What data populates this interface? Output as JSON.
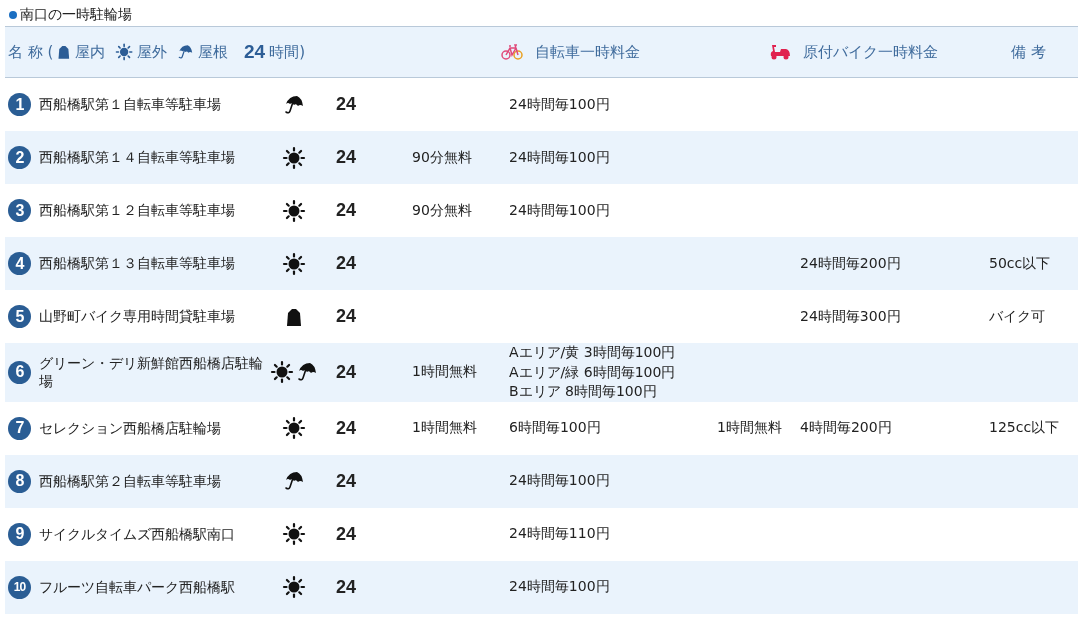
{
  "title": "南口の一時駐輪場",
  "header": {
    "name_label": "名 称 (",
    "legend": [
      {
        "kind": "indoor",
        "label": "屋内"
      },
      {
        "kind": "outdoor",
        "label": "屋外"
      },
      {
        "kind": "roof",
        "label": "屋根"
      },
      {
        "kind": "hours",
        "mark": "24",
        "label": "時間)"
      }
    ],
    "bicycle_fee": "自転車一時料金",
    "moped_fee": "原付バイク一時料金",
    "remarks": "備 考"
  },
  "rows": [
    {
      "number": "1",
      "name": "西船橋駅第１自転車等駐車場",
      "facilities": {
        "outdoor": false,
        "roof": true,
        "indoor": false
      },
      "hours": "24",
      "bicycle_fee": [
        "24時間毎100円"
      ]
    },
    {
      "number": "2",
      "name": "西船橋駅第１４自転車等駐車場",
      "facilities": {
        "outdoor": true,
        "roof": false,
        "indoor": false
      },
      "hours": "24",
      "bicycle_free": "90分無料",
      "bicycle_fee": [
        "24時間毎100円"
      ]
    },
    {
      "number": "3",
      "name": "西船橋駅第１２自転車等駐車場",
      "facilities": {
        "outdoor": true,
        "roof": false,
        "indoor": false
      },
      "hours": "24",
      "bicycle_free": "90分無料",
      "bicycle_fee": [
        "24時間毎100円"
      ]
    },
    {
      "number": "4",
      "name": "西船橋駅第１３自転車等駐車場",
      "facilities": {
        "outdoor": true,
        "roof": false,
        "indoor": false
      },
      "hours": "24",
      "moped_fee": "24時間毎200円",
      "remarks": "50cc以下"
    },
    {
      "number": "5",
      "name": "山野町バイク専用時間貸駐車場",
      "facilities": {
        "outdoor": false,
        "roof": false,
        "indoor": true
      },
      "hours": "24",
      "moped_fee": "24時間毎300円",
      "remarks": "バイク可"
    },
    {
      "number": "6",
      "name": "グリーン・デリ新鮮館西船橋店駐輪場",
      "facilities": {
        "outdoor": true,
        "roof": true,
        "indoor": false
      },
      "hours": "24",
      "bicycle_free": "1時間無料",
      "bicycle_fee": [
        "Aエリア/黄 3時間毎100円",
        "Aエリア/緑 6時間毎100円",
        "Bエリア 8時間毎100円"
      ]
    },
    {
      "number": "7",
      "name": "セレクション西船橋店駐輪場",
      "facilities": {
        "outdoor": true,
        "roof": false,
        "indoor": false
      },
      "hours": "24",
      "bicycle_free": "1時間無料",
      "bicycle_fee": [
        "6時間毎100円"
      ],
      "moped_free": "1時間無料",
      "moped_fee": "4時間毎200円",
      "remarks": "125cc以下"
    },
    {
      "number": "8",
      "name": "西船橋駅第２自転車等駐車場",
      "facilities": {
        "outdoor": false,
        "roof": true,
        "indoor": false
      },
      "hours": "24",
      "bicycle_fee": [
        "24時間毎100円"
      ]
    },
    {
      "number": "9",
      "name": "サイクルタイムズ西船橋駅南口",
      "facilities": {
        "outdoor": true,
        "roof": false,
        "indoor": false
      },
      "hours": "24",
      "bicycle_fee": [
        "24時間毎110円"
      ]
    },
    {
      "number": "10",
      "name": "フルーツ自転車パーク西船橋駅",
      "facilities": {
        "outdoor": true,
        "roof": false,
        "indoor": false
      },
      "hours": "24",
      "bicycle_fee": [
        "24時間毎100円"
      ]
    }
  ]
}
